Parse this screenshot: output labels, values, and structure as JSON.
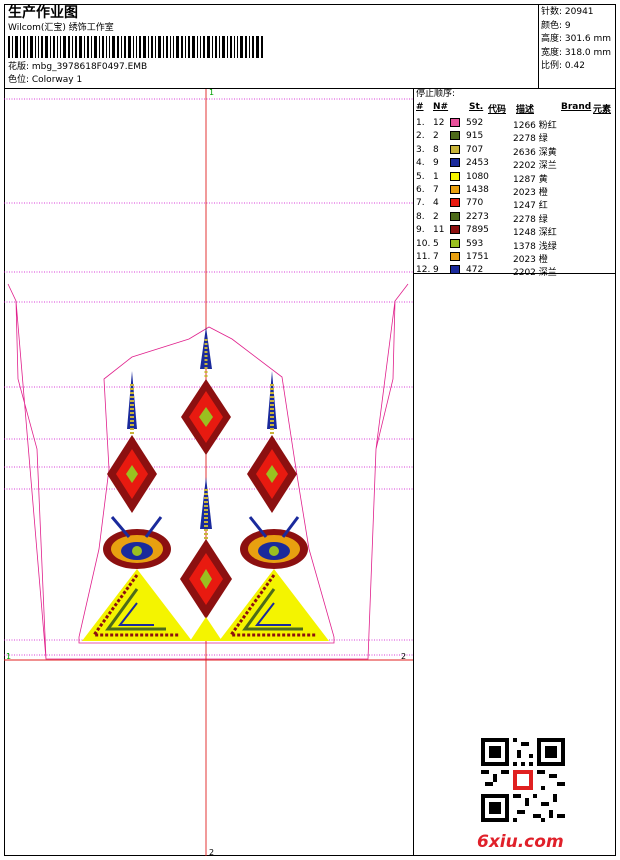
{
  "header": {
    "title": "生产作业图",
    "company": "Wilcom(汇宝) 绣饰工作室",
    "file_label": "花版: mbg_3978618F0497.EMB",
    "colorway_label": "色位: Colorway 1"
  },
  "stats": [
    "针数: 20941",
    "颜色: 9",
    "高度: 301.6 mm",
    "宽度: 318.0 mm",
    "比例: 0.42"
  ],
  "sequence": {
    "title": "停止顺序:",
    "headers": [
      "#",
      "N#",
      "St.",
      "代码",
      "描述",
      "Brand",
      "元素"
    ],
    "rows": [
      {
        "index": "1.",
        "n": "12",
        "color": "#e8509a",
        "code": "592",
        "desc": "1266 粉红"
      },
      {
        "index": "2.",
        "n": "2",
        "color": "#4d6b1a",
        "code": "915",
        "desc": "2278 绿"
      },
      {
        "index": "3.",
        "n": "8",
        "color": "#c8b43a",
        "code": "707",
        "desc": "2636 深黄"
      },
      {
        "index": "4.",
        "n": "9",
        "color": "#1a2a9c",
        "code": "2453",
        "desc": "2202 深兰"
      },
      {
        "index": "5.",
        "n": "1",
        "color": "#f4f400",
        "code": "1080",
        "desc": "1287 黄"
      },
      {
        "index": "6.",
        "n": "7",
        "color": "#e8a010",
        "code": "1438",
        "desc": "2023 橙"
      },
      {
        "index": "7.",
        "n": "4",
        "color": "#e81a10",
        "code": "770",
        "desc": "1247 红"
      },
      {
        "index": "8.",
        "n": "2",
        "color": "#4d6b1a",
        "code": "2273",
        "desc": "2278 绿"
      },
      {
        "index": "9.",
        "n": "11",
        "color": "#8c1010",
        "code": "7895",
        "desc": "1248 深红"
      },
      {
        "index": "10.",
        "n": "5",
        "color": "#9ac020",
        "code": "593",
        "desc": "1378 浅绿"
      },
      {
        "index": "11.",
        "n": "7",
        "color": "#e8a010",
        "code": "1751",
        "desc": "2023 橙"
      },
      {
        "index": "12.",
        "n": "9",
        "color": "#1a2a9c",
        "code": "472",
        "desc": "2202 深兰"
      }
    ]
  },
  "markers": {
    "top": "1",
    "bottom": "2",
    "left": "1",
    "right": "2"
  },
  "watermark": "6xiu.com",
  "colors": {
    "guide": "#cc00cc",
    "axis": "#e02020",
    "outline": "#e0208c",
    "marker_green": "#00a000"
  }
}
